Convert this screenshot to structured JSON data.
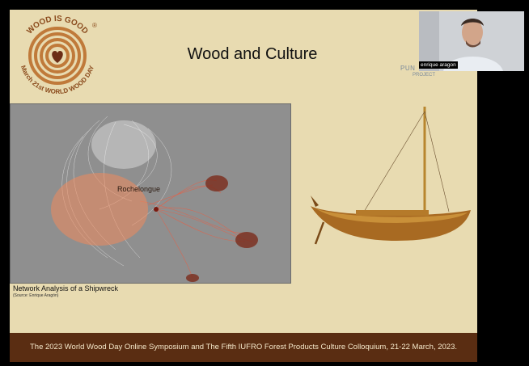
{
  "logo": {
    "top_text": "WOOD IS GOOD",
    "bottom_text": "March 21st WORLD WOOD DAY",
    "reg": "®"
  },
  "slide": {
    "title": "Wood and Culture",
    "network_center_label": "Rochelongue",
    "caption": "Network Analysis of a Shipwreck",
    "source": "(Source: Enrique Aragón)"
  },
  "footer": {
    "text": "The 2023 World Wood Day Online Symposium and The Fifth IUFRO Forest Products Culture Colloquium, 21-22 March, 2023."
  },
  "participant": {
    "name": "enrique aragon",
    "project_title": "PUN",
    "project_sub": "PROJECT"
  },
  "colors": {
    "slide_bg": "#e8dbb1",
    "footer_bg": "#5a2d12",
    "accent": "#b86a2a"
  }
}
